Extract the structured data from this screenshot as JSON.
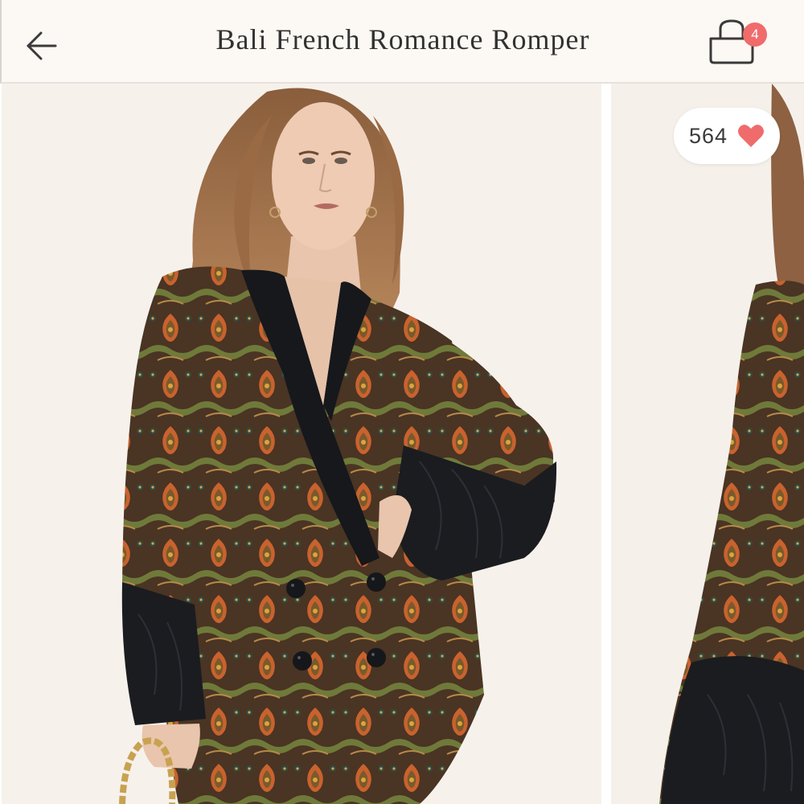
{
  "header": {
    "title": "Bali French Romance Romper",
    "cart_count": "4"
  },
  "likes": {
    "count": "564"
  },
  "icons": {
    "back": "arrow-left-icon",
    "cart": "shopping-bag-icon",
    "like": "heart-icon"
  },
  "colors": {
    "accent": "#f06b6b",
    "header_bg": "#fcf8f3",
    "photo_bg": "#f7f1ec",
    "print_rust": "#c9622f",
    "print_dark": "#3a2a1e",
    "collar_black": "#15171b"
  },
  "gallery": {
    "slides": [
      {
        "alt": "Model wearing paisley print romper jacket, front view"
      },
      {
        "alt": "Model wearing paisley print romper, side view"
      }
    ]
  }
}
